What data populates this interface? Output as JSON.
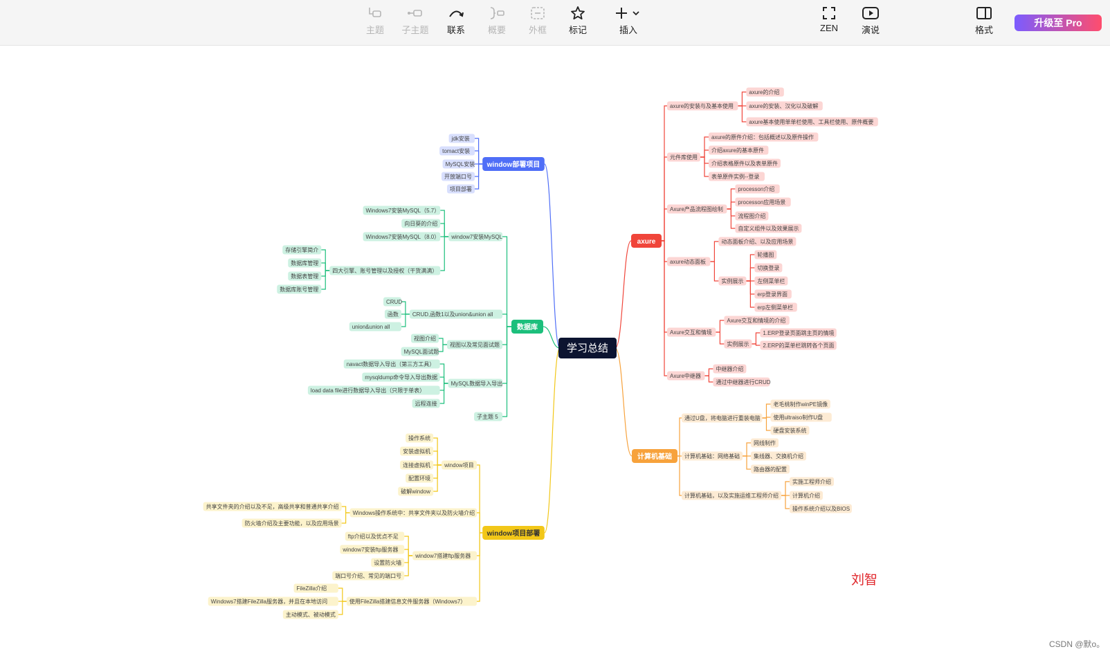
{
  "toolbar": {
    "buttons": [
      {
        "id": "topic",
        "label": "主题",
        "icon": "topic-icon",
        "enabled": false
      },
      {
        "id": "subtopic",
        "label": "子主题",
        "icon": "subtopic-icon",
        "enabled": false
      },
      {
        "id": "relation",
        "label": "联系",
        "icon": "relation-curve-icon",
        "enabled": true
      },
      {
        "id": "summary",
        "label": "概要",
        "icon": "summary-bracket-icon",
        "enabled": false
      },
      {
        "id": "boundary",
        "label": "外框",
        "icon": "boundary-icon",
        "enabled": false
      },
      {
        "id": "marker",
        "label": "标记",
        "icon": "star-icon",
        "enabled": true
      },
      {
        "id": "insert",
        "label": "插入",
        "icon": "plus-icon",
        "enabled": true
      },
      {
        "id": "zen",
        "label": "ZEN",
        "icon": "fullscreen-icon",
        "enabled": true
      },
      {
        "id": "present",
        "label": "演说",
        "icon": "play-icon",
        "enabled": true
      },
      {
        "id": "format",
        "label": "格式",
        "icon": "panel-icon",
        "enabled": true
      }
    ],
    "pro_label": "升级至 Pro"
  },
  "mindmap": {
    "root": "学习总结",
    "branches": [
      {
        "label": "window部署项目",
        "color": "#4f6ef7",
        "children": [
          "jdk安装",
          "tomact安装",
          "MySQL安装",
          "开放端口号",
          "项目部署"
        ]
      },
      {
        "label": "数据库",
        "color": "#1cbf7c",
        "children": [
          {
            "label": "window7安装MySQL",
            "children": [
              "Windows7安装MySQL（5.7）",
              "向日葵的介绍",
              "Windows7安装MySQL（8.0）",
              {
                "label": "四大引擎、账号管理以及授权（干货满满）",
                "children": [
                  "存储引擎简介",
                  "数据库管理",
                  "数据表管理",
                  "数据库账号管理"
                ]
              }
            ]
          },
          {
            "label": "CRUD,函数1以及union&union all",
            "children": [
              "CRUD",
              "函数",
              "union&union all"
            ]
          },
          {
            "label": "视图以及常见面试题",
            "children": [
              "视图介绍",
              "MySQL面试题"
            ]
          },
          {
            "label": "MySQL数据导入导出",
            "children": [
              "navact数据导入导出（第三方工具）",
              "mysqldump命令导入导出数据",
              "load data file进行数据导入导出（只限于单表）",
              "远程连接"
            ]
          },
          "子主题 5"
        ]
      },
      {
        "label": "window项目部署",
        "color": "#f2c718",
        "children": [
          {
            "label": "window项目",
            "children": [
              "操作系统",
              "安装虚拟机",
              "连接虚拟机",
              "配置环境",
              "破解window"
            ]
          },
          {
            "label": "Windows操作系统中：共享文件夹以及防火墙介绍",
            "children": [
              "共享文件夹的介绍以及不足，高级共享和普通共享介绍",
              "防火墙介绍及主要功能，以及应用场景"
            ]
          },
          {
            "label": "window7搭建ftp服务器",
            "children": [
              "ftp介绍以及优点不足",
              "window7安装ftp服务器",
              "设置防火墙",
              "端口号介绍、常见的端口号"
            ]
          },
          {
            "label": "使用FileZilla搭建信息文件服务器（Windows7）",
            "children": [
              "FileZilla介绍",
              "Windows7搭建FileZilla服务器，并且在本地访问",
              "主动模式、被动模式"
            ]
          }
        ]
      },
      {
        "label": "axure",
        "color": "#f0453a",
        "children": [
          {
            "label": "axure的安装与及基本使用",
            "children": [
              "axure的介绍",
              "axure的安装、汉化以及破解",
              "axure基本使用单单栏使用、工具栏使用、原件概要"
            ]
          },
          {
            "label": "元件库使用",
            "children": [
              "axure的原件介绍：包括概述以及原件操作",
              "介绍axure的基本原件",
              "介绍表格原件以及表单原件",
              "表单原件实例--登录"
            ]
          },
          {
            "label": "Axure产品流程图绘制",
            "children": [
              "processon介绍",
              "processon应用场景",
              "流程图介绍",
              "自定义组件以及效果展示"
            ]
          },
          {
            "label": "axure动态面板",
            "children": [
              "动态面板介绍、以及应用场景",
              {
                "label": "实例展示",
                "children": [
                  "轮播图",
                  "切换登录",
                  "左侧菜单栏",
                  "erp登录界面",
                  "erp左侧菜单栏"
                ]
              }
            ]
          },
          {
            "label": "Axure交互和情境",
            "children": [
              "Axure交互和情境的介绍",
              {
                "label": "实例展示",
                "children": [
                  "1.ERP登录页面跳主页的情境",
                  "2.ERP的菜单栏跳转各个页面"
                ]
              }
            ]
          },
          {
            "label": "Axure中继器",
            "children": [
              "中继器介绍",
              "通过中继器进行CRUD"
            ]
          }
        ]
      },
      {
        "label": "计算机基础",
        "color": "#f7a23c",
        "children": [
          {
            "label": "通过U盘，将电脑进行重装电脑",
            "children": [
              "老毛桃制作winPE镜像",
              "使用ultraiso制作U盘",
              "硬盘安装系统"
            ]
          },
          {
            "label": "计算机基础：网络基础",
            "children": [
              "网线制作",
              "集线器、交换机介绍",
              "路由器的配置"
            ]
          },
          {
            "label": "计算机基础，以及实施运维工程师介绍",
            "children": [
              "实施工程师介绍",
              "计算机介绍",
              "操作系统介绍以及BIOS"
            ]
          }
        ]
      }
    ]
  },
  "watermark": {
    "author": "刘智",
    "csdn": "CSDN @默o。"
  }
}
